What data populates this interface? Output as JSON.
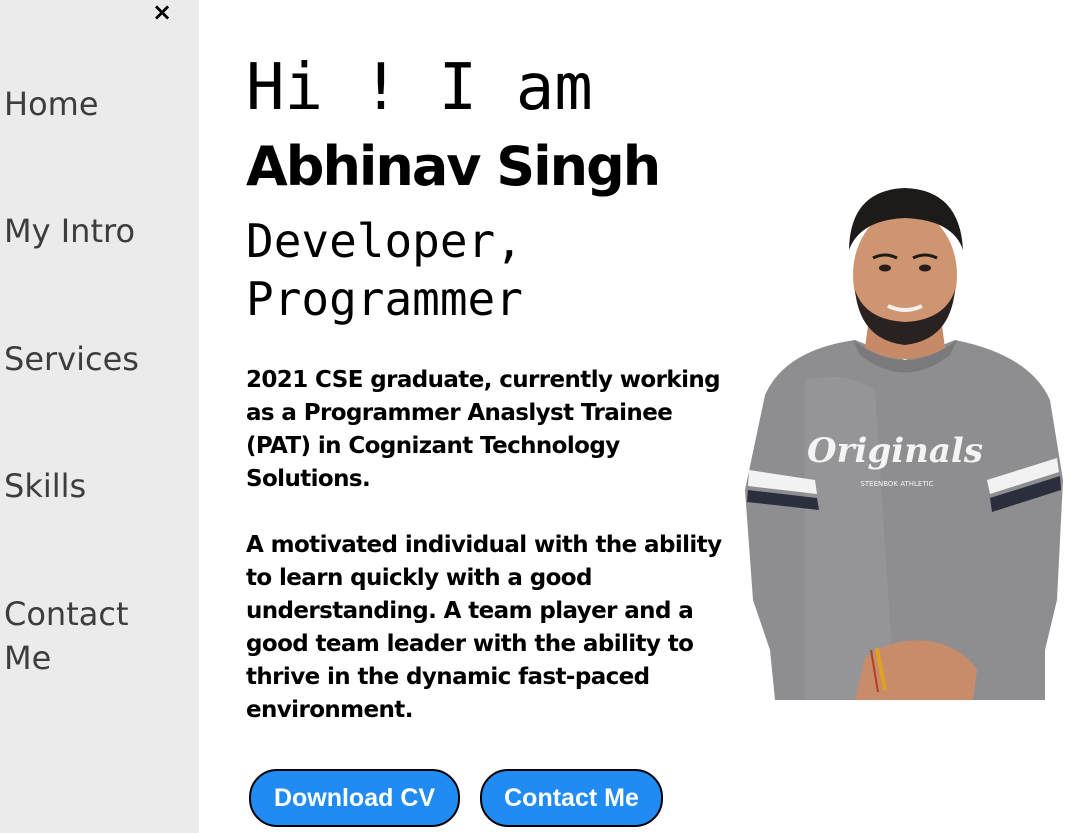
{
  "sidebar": {
    "close_label": "×",
    "items": [
      {
        "label": "Home"
      },
      {
        "label": "My Intro"
      },
      {
        "label": "Services"
      },
      {
        "label": "Skills"
      },
      {
        "label": "Contact Me"
      }
    ]
  },
  "hero": {
    "greeting": "Hi ! I am",
    "name": "Abhinav Singh",
    "role": "Developer, Programmer",
    "bio_1": "2021 CSE graduate, currently working as a Programmer Anaslyst Trainee (PAT) in Cognizant Technology Solutions.",
    "bio_2": "A motivated individual with the ability to learn quickly with a good understanding. A team player and a good team leader with the ability to thrive in the dynamic fast-paced environment."
  },
  "buttons": {
    "download_cv": "Download CV",
    "contact_me": "Contact Me"
  },
  "photo": {
    "shirt_text": "Originals",
    "shirt_subtext": "STEENBOK ATHLETIC"
  },
  "colors": {
    "sidebar_bg": "#ebebeb",
    "button_bg": "#1f8bf3",
    "nav_text": "#3d3d3d"
  }
}
